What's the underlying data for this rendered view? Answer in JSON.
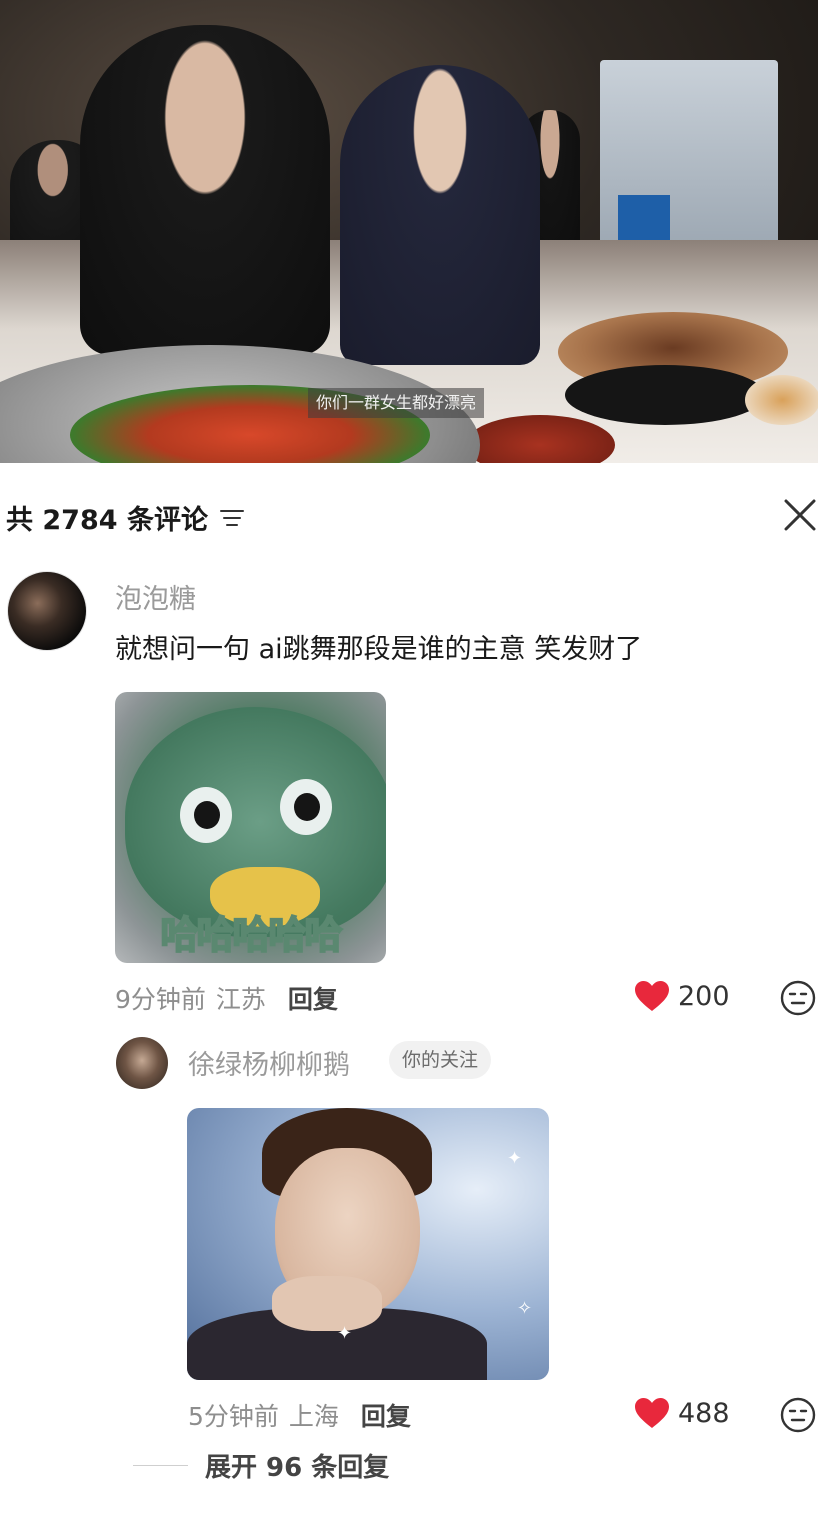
{
  "video": {
    "subtitle": "你们一群女生都好漂亮"
  },
  "comments_panel": {
    "count_label": "共 2784 条评论",
    "filter_icon": "filter-lines-icon",
    "close_icon": "close-x-icon"
  },
  "comments": [
    {
      "username": "泡泡糖",
      "text": "就想问一句 ai跳舞那段是谁的主意 笑发财了",
      "sticker_text": "哈哈哈哈哈",
      "time": "9分钟前",
      "location": "江苏",
      "reply_label": "回复",
      "likes": "200"
    },
    {
      "username": "徐绿杨柳柳鹅",
      "badge": "你的关注",
      "time": "5分钟前",
      "location": "上海",
      "reply_label": "回复",
      "likes": "488",
      "expand_label": "展开 96 条回复"
    }
  ],
  "colors": {
    "like_red": "#e8283c",
    "meta_gray": "#8e8e8e",
    "username_gray": "#9a9a9a"
  }
}
